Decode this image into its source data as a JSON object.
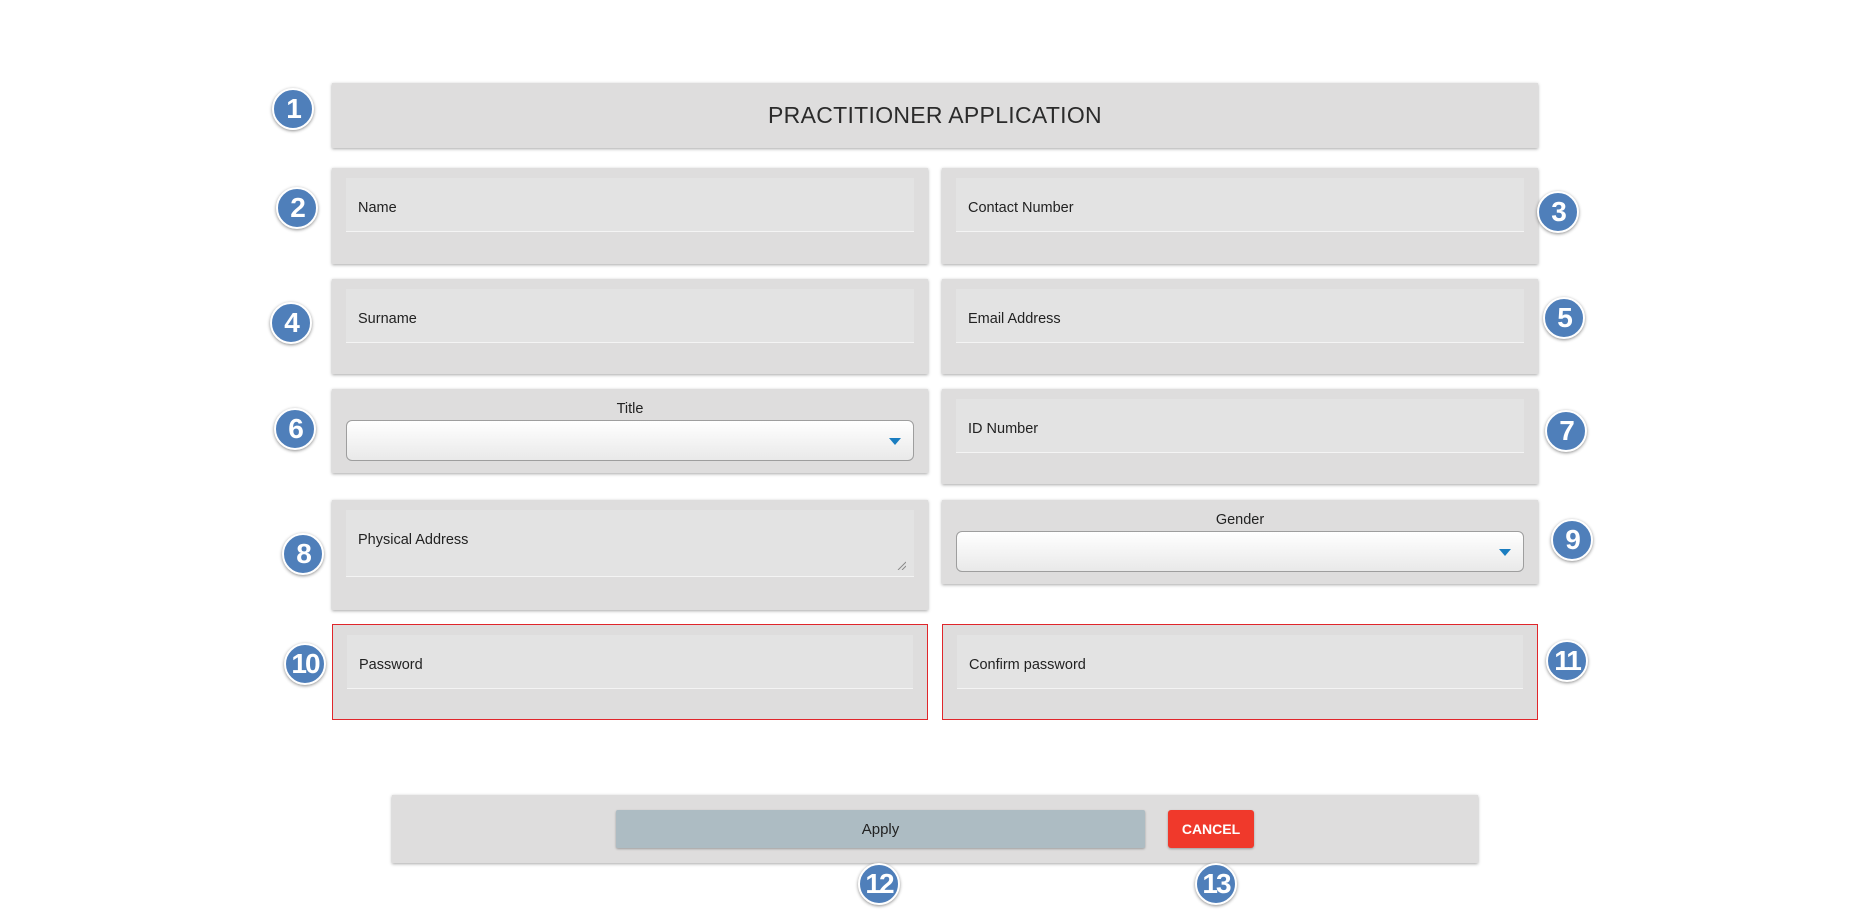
{
  "form": {
    "title": "PRACTITIONER APPLICATION",
    "fields": {
      "name": "Name",
      "contact_number": "Contact Number",
      "surname": "Surname",
      "email_address": "Email Address",
      "id_number": "ID Number",
      "physical_address": "Physical Address",
      "password": "Password",
      "confirm_password": "Confirm password"
    },
    "selects": {
      "title_label": "Title",
      "title_value": "",
      "gender_label": "Gender",
      "gender_value": ""
    }
  },
  "actions": {
    "apply_label": "Apply",
    "cancel_label": "CANCEL"
  },
  "markers": [
    "1",
    "2",
    "3",
    "4",
    "5",
    "6",
    "7",
    "8",
    "9",
    "10",
    "11",
    "12",
    "13"
  ],
  "colors": {
    "panel": "#dedddd",
    "error_border": "#e0262b",
    "apply": "#adbcc3",
    "cancel": "#f0392b",
    "marker": "#4f7fba",
    "select_arrow": "#1a7dc0"
  },
  "icons": {
    "select_arrow": "caret-down-icon",
    "resize_grip": "resize-grip-icon"
  }
}
